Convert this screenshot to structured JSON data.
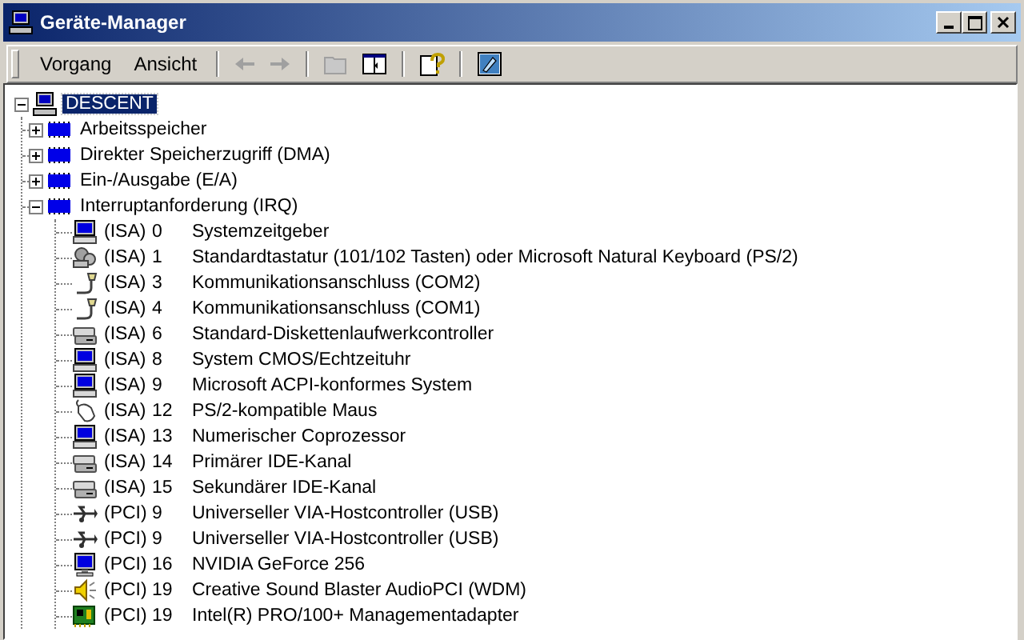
{
  "window": {
    "title": "Geräte-Manager"
  },
  "menu": [
    "Vorgang",
    "Ansicht"
  ],
  "toolbar": [
    {
      "kind": "back",
      "disabled": true
    },
    {
      "kind": "forward",
      "disabled": true
    },
    {
      "kind": "sep"
    },
    {
      "kind": "folder",
      "disabled": true
    },
    {
      "kind": "panes",
      "disabled": false
    },
    {
      "kind": "sep"
    },
    {
      "kind": "help",
      "disabled": false
    },
    {
      "kind": "sep"
    },
    {
      "kind": "properties",
      "disabled": false
    }
  ],
  "tree": {
    "label": "DESCENT",
    "kind": "computer",
    "selected": true,
    "expanded": true,
    "children": [
      {
        "label": "Arbeitsspeicher",
        "kind": "chip",
        "selected": false,
        "expanded": false
      },
      {
        "label": "Direkter Speicherzugriff (DMA)",
        "kind": "chip",
        "selected": false,
        "expanded": false
      },
      {
        "label": "Ein-/Ausgabe (E/A)",
        "kind": "chip",
        "selected": false,
        "expanded": false
      },
      {
        "label": "Interruptanforderung (IRQ)",
        "kind": "chip",
        "selected": false,
        "expanded": true,
        "children": [
          {
            "bus": "(ISA)",
            "irq": "0",
            "label": "Systemzeitgeber",
            "kind": "system",
            "selected": false
          },
          {
            "bus": "(ISA)",
            "irq": "1",
            "label": "Standardtastatur (101/102 Tasten) oder Microsoft Natural Keyboard (PS/2)",
            "kind": "keyboard",
            "selected": false
          },
          {
            "bus": "(ISA)",
            "irq": "3",
            "label": "Kommunikationsanschluss (COM2)",
            "kind": "port",
            "selected": false
          },
          {
            "bus": "(ISA)",
            "irq": "4",
            "label": "Kommunikationsanschluss (COM1)",
            "kind": "port",
            "selected": false
          },
          {
            "bus": "(ISA)",
            "irq": "6",
            "label": "Standard-Diskettenlaufwerkcontroller",
            "kind": "drive",
            "selected": false
          },
          {
            "bus": "(ISA)",
            "irq": "8",
            "label": "System CMOS/Echtzeituhr",
            "kind": "system",
            "selected": false
          },
          {
            "bus": "(ISA)",
            "irq": "9",
            "label": "Microsoft ACPI-konformes System",
            "kind": "system",
            "selected": false
          },
          {
            "bus": "(ISA)",
            "irq": "12",
            "label": "PS/2-kompatible Maus",
            "kind": "mouse",
            "selected": false
          },
          {
            "bus": "(ISA)",
            "irq": "13",
            "label": "Numerischer Coprozessor",
            "kind": "system",
            "selected": false
          },
          {
            "bus": "(ISA)",
            "irq": "14",
            "label": "Primärer IDE-Kanal",
            "kind": "drive",
            "selected": false
          },
          {
            "bus": "(ISA)",
            "irq": "15",
            "label": "Sekundärer IDE-Kanal",
            "kind": "drive",
            "selected": false
          },
          {
            "bus": "(PCI)",
            "irq": "9",
            "label": "Universeller VIA-Hostcontroller (USB)",
            "kind": "usb",
            "selected": false
          },
          {
            "bus": "(PCI)",
            "irq": "9",
            "label": "Universeller VIA-Hostcontroller (USB)",
            "kind": "usb",
            "selected": false
          },
          {
            "bus": "(PCI)",
            "irq": "16",
            "label": "NVIDIA GeForce 256",
            "kind": "display",
            "selected": false
          },
          {
            "bus": "(PCI)",
            "irq": "19",
            "label": "Creative Sound Blaster AudioPCI (WDM)",
            "kind": "sound",
            "selected": false
          },
          {
            "bus": "(PCI)",
            "irq": "19",
            "label": "Intel(R) PRO/100+ Managementadapter",
            "kind": "network",
            "selected": false
          }
        ]
      }
    ]
  }
}
